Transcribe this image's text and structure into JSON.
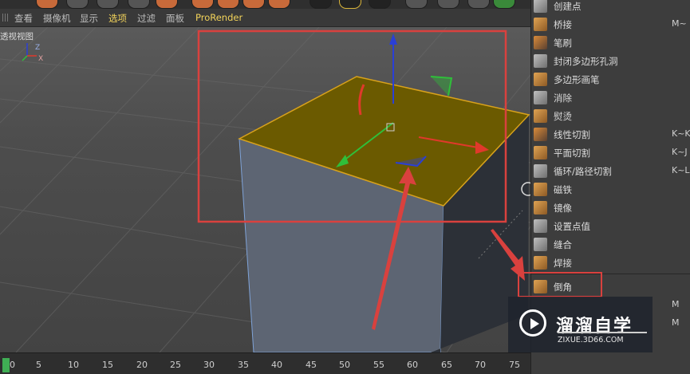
{
  "menu": {
    "items": [
      "查看",
      "摄像机",
      "显示",
      "选项",
      "过滤",
      "面板",
      "ProRender"
    ],
    "active_index": 3
  },
  "viewport": {
    "label": "透视视图"
  },
  "timeline": {
    "current_frame": "0",
    "ticks": [
      "0",
      "5",
      "10",
      "15",
      "20",
      "25",
      "30",
      "35",
      "40",
      "45",
      "50",
      "55",
      "60",
      "65",
      "70",
      "75"
    ]
  },
  "tools": [
    {
      "label": "创建点",
      "shortcut": "",
      "icon": "create-point-icon"
    },
    {
      "label": "桥接",
      "shortcut": "M~",
      "icon": "bridge-icon"
    },
    {
      "label": "笔刷",
      "shortcut": "",
      "icon": "brush-icon"
    },
    {
      "label": "封闭多边形孔洞",
      "shortcut": "",
      "icon": "close-polygon-hole-icon"
    },
    {
      "label": "多边形画笔",
      "shortcut": "",
      "icon": "polygon-pen-icon"
    },
    {
      "label": "消除",
      "shortcut": "",
      "icon": "dissolve-icon"
    },
    {
      "label": "熨烫",
      "shortcut": "",
      "icon": "iron-icon"
    },
    {
      "label": "线性切割",
      "shortcut": "K~K,",
      "icon": "line-cut-icon"
    },
    {
      "label": "平面切割",
      "shortcut": "K~J",
      "icon": "plane-cut-icon"
    },
    {
      "label": "循环/路径切割",
      "shortcut": "K~L",
      "icon": "loop-path-cut-icon"
    },
    {
      "label": "磁铁",
      "shortcut": "",
      "icon": "magnet-icon"
    },
    {
      "label": "镜像",
      "shortcut": "",
      "icon": "mirror-icon"
    },
    {
      "label": "设置点值",
      "shortcut": "",
      "icon": "set-point-value-icon"
    },
    {
      "label": "缝合",
      "shortcut": "",
      "icon": "stitch-icon"
    },
    {
      "label": "焊接",
      "shortcut": "",
      "icon": "weld-icon"
    },
    {
      "label": "倒角",
      "shortcut": "",
      "icon": "bevel-icon"
    },
    {
      "label": "",
      "shortcut": "M",
      "icon": ""
    },
    {
      "label": "",
      "shortcut": "M",
      "icon": ""
    }
  ],
  "watermark": {
    "title": "溜溜自学",
    "url": "ZIXUE.3D66.COM"
  },
  "colors": {
    "selection_face": "#6b5a00",
    "annotation_red": "#d9413e",
    "axis_x": "#e0392b",
    "axis_y": "#2fbf3a",
    "axis_z": "#2a3fd6",
    "active_menu": "#f2d35a"
  }
}
